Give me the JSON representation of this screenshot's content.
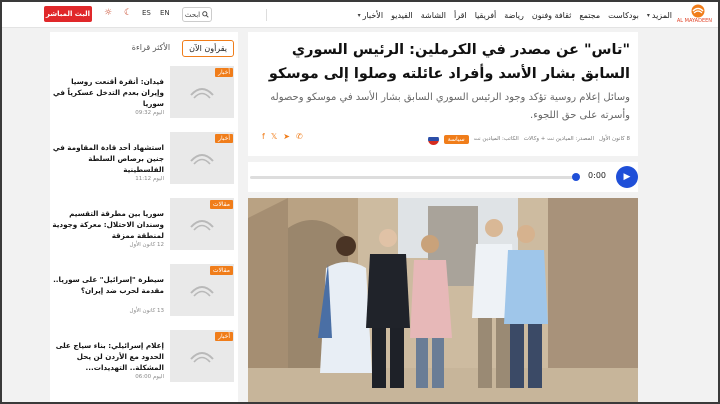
{
  "brand": {
    "logo_text": "AL MAYADEEN",
    "accent": "#f07d1a",
    "live_red": "#e0282a",
    "play_blue": "#1f4fd8"
  },
  "nav": {
    "items": [
      {
        "label": "الأخبار",
        "caret": true
      },
      {
        "label": "الفيديو"
      },
      {
        "label": "الشاشة"
      },
      {
        "label": "اقرأ"
      },
      {
        "label": "أفريقيا"
      },
      {
        "label": "رياضة"
      },
      {
        "label": "ثقافة وفنون"
      },
      {
        "label": "مجتمع"
      },
      {
        "label": "بودكاست"
      },
      {
        "label": "المزيد",
        "caret": true
      }
    ],
    "search_label": "ابحث",
    "lang_en": "EN",
    "lang_es": "ES",
    "live_label": "البث المباشر",
    "icon_theme_1": "moon-icon",
    "icon_theme_2": "sun-icon"
  },
  "article": {
    "headline": "\"تاس\" عن مصدر في الكرملين: الرئيس السوري السابق بشار الأسد وأفراد عائلته وصلوا إلى موسكو",
    "subline": "وسائل إعلام روسية تؤكد وجود الرئيس السوري السابق بشار الأسد في موسكو وحصوله وأسرته على حق اللجوء.",
    "tag": "سياسة",
    "author": "الكاتب: الميادين نت",
    "source": "المصدر: الميادين نت + وكالات",
    "date": "8 كانون الأول",
    "flag": {
      "top": "#ffffff",
      "mid": "#2b4ea8",
      "bottom": "#d52b1e"
    }
  },
  "audio": {
    "time": "0:00",
    "progress": 0
  },
  "sidebar": {
    "tab_active": "يقرأون الآن",
    "tab_other": "الأكثر قراءة",
    "items": [
      {
        "tag": "أخبار",
        "title": "فيدان: أنقرة أقنعت روسيا وإيران بعدم التدخل عسكرياً في سوريا",
        "date": "اليوم 09:32"
      },
      {
        "tag": "أخبار",
        "title": "استشهاد أحد قادة المقاومة في جنين برصاص السلطة الفلسطينية",
        "date": "اليوم 11:12"
      },
      {
        "tag": "مقالات",
        "title": "سوريا بين مطرقة التقسيم وسندان الاحتلال: معركة وجودية لمنطقة ممزقة",
        "date": "12 كانون الأول"
      },
      {
        "tag": "مقالات",
        "title": "سيطرة \"إسرائيل\" على سوريا.. مقدمة لحرب ضد إيران؟",
        "date": "13 كانون الأول"
      },
      {
        "tag": "أخبار",
        "title": "إعلام إسرائيلي: بناء سياج على الحدود مع الأردن لن يحل المشكلة.. التهديدات...",
        "date": "اليوم 06:00"
      }
    ]
  }
}
